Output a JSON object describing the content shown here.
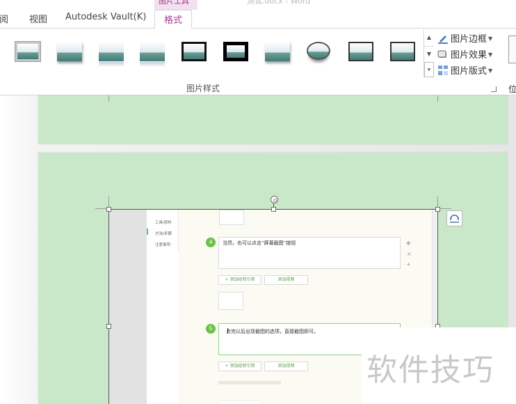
{
  "window": {
    "doc_title": "测试.docx - Word",
    "tool_group": "图片工具"
  },
  "tabs": [
    {
      "label": "审阅"
    },
    {
      "label": "视图"
    },
    {
      "label": "Autodesk Vault(K)"
    },
    {
      "label": "格式",
      "active": true
    }
  ],
  "ribbon": {
    "group_label": "图片样式",
    "styles": [
      "simple-frame-white",
      "soft-edge-rectangle",
      "reflected-rounded",
      "reflected-bevel",
      "thick-matte-black",
      "simple-frame-black",
      "drop-shadow-rectangle",
      "oval",
      "metal-frame",
      "center-shadow-rectangle"
    ],
    "commands": {
      "border": "图片边框",
      "effects": "图片效果",
      "layout": "图片版式"
    },
    "right_cut_label": "位"
  },
  "document": {
    "embedded_image": {
      "nav_items": [
        "工具/原料",
        "方法/步骤",
        "注意事项"
      ],
      "steps": [
        {
          "number": "4",
          "text": "当然，也可以点击“屏幕截图”按钮"
        },
        {
          "number": "5",
          "text": "点完以后出现截图的选项，直接截图即可。"
        }
      ],
      "buttons": {
        "add_experience": "+ 添加经验引用",
        "add_video": "添加视频"
      }
    }
  },
  "watermark": "软件技巧",
  "colors": {
    "accent": "#a43a8f",
    "tool_group_bg": "#f3dff0",
    "page_green": "#c9e8c9",
    "step_green": "#6cc04a"
  }
}
